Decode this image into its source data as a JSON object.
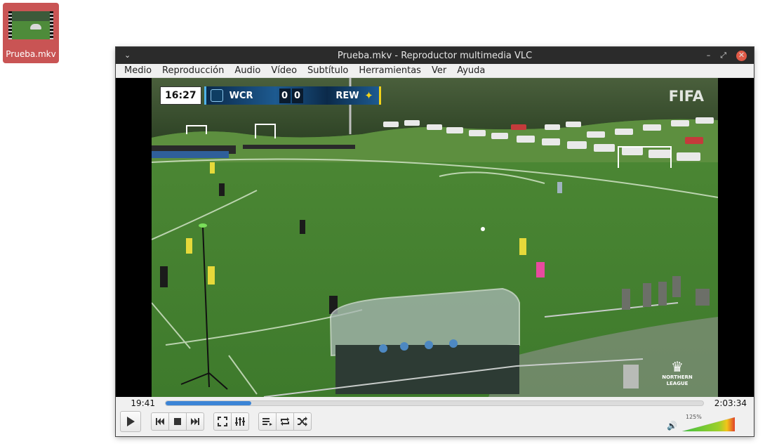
{
  "desktop": {
    "file_icon_label": "Prueba.mkv"
  },
  "window": {
    "title": "Prueba.mkv - Reproductor multimedia VLC",
    "window_menu_glyph": "⌄",
    "minimize_glyph": "–",
    "maximize_glyph": "⤢",
    "close_glyph": "✕"
  },
  "menubar": {
    "items": [
      "Medio",
      "Reproducción",
      "Audio",
      "Vídeo",
      "Subtítulo",
      "Herramientas",
      "Ver",
      "Ayuda"
    ]
  },
  "video": {
    "scorebug": {
      "clock": "16:27",
      "home_team": "WCR",
      "home_score": "0",
      "away_score": "0",
      "away_team": "REW"
    },
    "broadcast_logo": "FIFA",
    "league_logo_text": "NORTHERN\nLEAGUE"
  },
  "playback": {
    "elapsed": "19:41",
    "total": "2:03:34",
    "progress_fraction": 0.159
  },
  "volume": {
    "label": "125%",
    "level_fraction": 1.0
  },
  "colors": {
    "accent": "#3b84d6",
    "titlebar": "#2b2b2b",
    "close": "#e05a47"
  }
}
